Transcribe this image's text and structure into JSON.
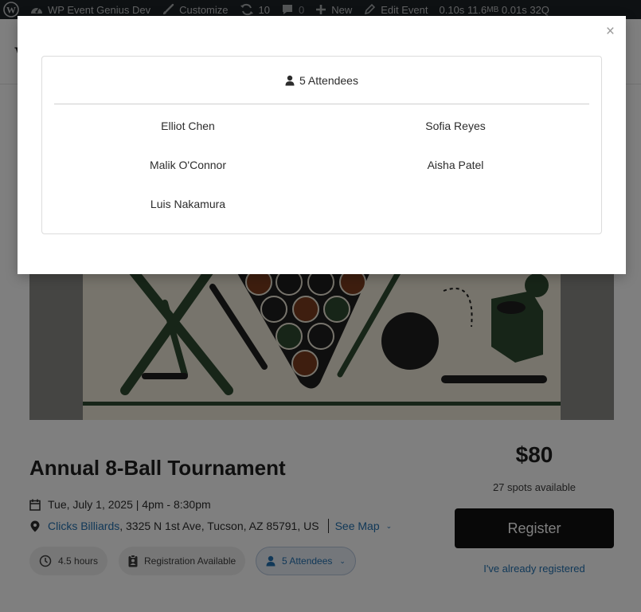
{
  "admin_bar": {
    "site_name": "WP Event Genius Dev",
    "customize": "Customize",
    "updates": "10",
    "comments": "0",
    "new": "New",
    "edit": "Edit Event",
    "perf_time": "0.10s",
    "perf_mem": "11.6",
    "perf_mem_unit": "MB",
    "perf_db_time": "0.01s",
    "perf_queries": "32Q"
  },
  "event": {
    "title": "Annual 8-Ball Tournament",
    "date": "Tue, July 1, 2025 | 4pm - 8:30pm",
    "venue": "Clicks Billiards",
    "address": ", 3325 N 1st Ave, Tucson, AZ 85791, US",
    "see_map": "See Map",
    "duration": "4.5 hours",
    "registration_status": "Registration Available",
    "attendees_pill": "5 Attendees",
    "price": "$80",
    "spots": "27 spots available",
    "register_label": "Register",
    "already_registered": "I've already registered"
  },
  "modal": {
    "close_glyph": "×",
    "header": "5 Attendees",
    "attendees": [
      "Elliot Chen",
      "Sofia Reyes",
      "Malik O'Connor",
      "Aisha Patel",
      "Luis Nakamura"
    ]
  },
  "colors": {
    "link": "#2271b1",
    "admin_bar_bg": "#1d2327",
    "register_bg": "#111111",
    "overlay": "rgba(0,0,0,0.5)"
  },
  "icons": {
    "wordpress": "wordpress-icon",
    "site": "dashboard-icon",
    "customize": "paintbrush-icon",
    "updates": "refresh-icon",
    "comments": "comment-icon",
    "new": "plus-icon",
    "edit": "pencil-icon",
    "date": "calendar-icon",
    "location": "map-pin-icon",
    "duration": "clock-icon",
    "registration": "clipboard-icon",
    "attendees": "user-icon",
    "close": "close-icon"
  }
}
